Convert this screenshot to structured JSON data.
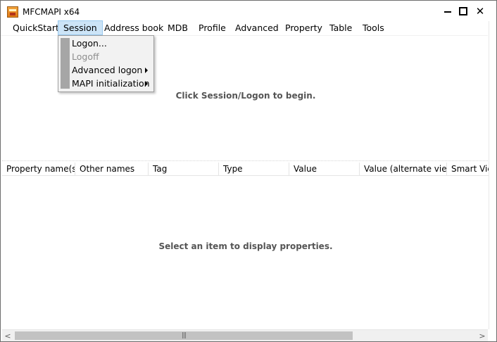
{
  "window": {
    "title": "MFCMAPI x64"
  },
  "menubar": {
    "items": [
      {
        "label": "QuickStart"
      },
      {
        "label": "Session"
      },
      {
        "label": "Address book"
      },
      {
        "label": "MDB"
      },
      {
        "label": "Profile"
      },
      {
        "label": "Advanced"
      },
      {
        "label": "Property"
      },
      {
        "label": "Table"
      },
      {
        "label": "Tools"
      }
    ],
    "active": "Session"
  },
  "session_menu": {
    "items": [
      {
        "label": "Logon...",
        "enabled": true,
        "submenu": false
      },
      {
        "label": "Logoff",
        "enabled": false,
        "submenu": false
      },
      {
        "label": "Advanced logon",
        "enabled": true,
        "submenu": true
      },
      {
        "label": "MAPI initialization",
        "enabled": true,
        "submenu": true
      }
    ]
  },
  "upper_pane": {
    "hint": "Click Session/Logon to begin."
  },
  "property_list": {
    "columns": [
      {
        "label": "Property name(s)"
      },
      {
        "label": "Other names"
      },
      {
        "label": "Tag"
      },
      {
        "label": "Type"
      },
      {
        "label": "Value"
      },
      {
        "label": "Value (alternate view)"
      },
      {
        "label": "Smart View"
      }
    ],
    "hint": "Select an item to display properties."
  },
  "icons": {
    "app": "mfcmapi-app-icon",
    "minimize": "minimize-icon",
    "maximize": "maximize-icon",
    "close": "close-icon",
    "submenu": "submenu-arrow-icon",
    "scroll_left": "scroll-left-icon",
    "scroll_right": "scroll-right-icon"
  },
  "colors": {
    "menu_highlight": "#cce4f7",
    "menu_highlight_border": "#99c9ef",
    "dropdown_bg": "#f2f2f2",
    "gutter": "#a6a6a6",
    "hint_text": "#555555",
    "disabled_text": "#8d8d8d"
  }
}
